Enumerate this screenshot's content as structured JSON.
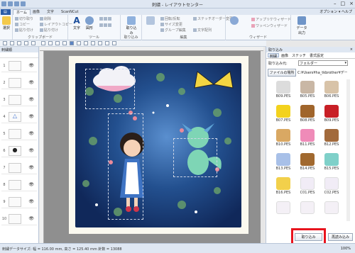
{
  "window": {
    "title": "刺繍 - レイアウトセンター"
  },
  "tabs": [
    "ホーム",
    "画像",
    "文字",
    "ScanNCut"
  ],
  "tabs_right": "オプション ▾ ヘルプ",
  "ribbon": {
    "select": {
      "label": "選択"
    },
    "clipboard_group": "クリップボード",
    "clipboard_items": [
      "切り取り",
      "コピー",
      "貼り付け",
      "削除",
      "レイアウトコピー",
      "貼り付け"
    ],
    "tools_group": "ツール",
    "text_label": "文字",
    "shape_label": "図形",
    "import_group": "取り込み",
    "import_label": "取り込み",
    "edit_group": "編集",
    "wizard_group": "ウィザード",
    "output_label": "データ出力",
    "small_items": [
      "回転/反転",
      "サイズ変更",
      "グループ編集",
      "ステッチオーダー変更",
      "文字配列",
      "アップリケウィザード",
      "ワッペンウィザード"
    ]
  },
  "left_panel": {
    "title": "刺繍順",
    "rows": [
      "1",
      "2",
      "3",
      "4",
      "5",
      "6",
      "7",
      "8",
      "9",
      "10"
    ]
  },
  "right_panel": {
    "title": "取り込み",
    "tabs": [
      "刺繍",
      "画像",
      "ステッチ",
      "書式設定"
    ],
    "from_label": "取り込み元:",
    "from_value": "フォルダー",
    "folder_button": "ファイルの場所",
    "folder_path": "C:¥Users¥ha_tkbrother¥データ",
    "items": [
      "B09.PES",
      "B05.PES",
      "B06.PES",
      "B07.PES",
      "B08.PES",
      "B09.PES",
      "B10.PES",
      "B11.PES",
      "B12.PES",
      "B13.PES",
      "B14.PES",
      "B15.PES",
      "B16.PES",
      "C01.PES",
      "C02.PES"
    ],
    "import_button": "取り込み",
    "resume_button": "再読み込み"
  },
  "status": {
    "text": "刺繍データサイズ: 幅 = 116.00 mm, 高さ = 125.40 mm 針数 = 13088",
    "zoom": "100%"
  },
  "colors": {
    "accent_red": "#e8141e",
    "ribbon_bg": "#f5f8fc"
  }
}
